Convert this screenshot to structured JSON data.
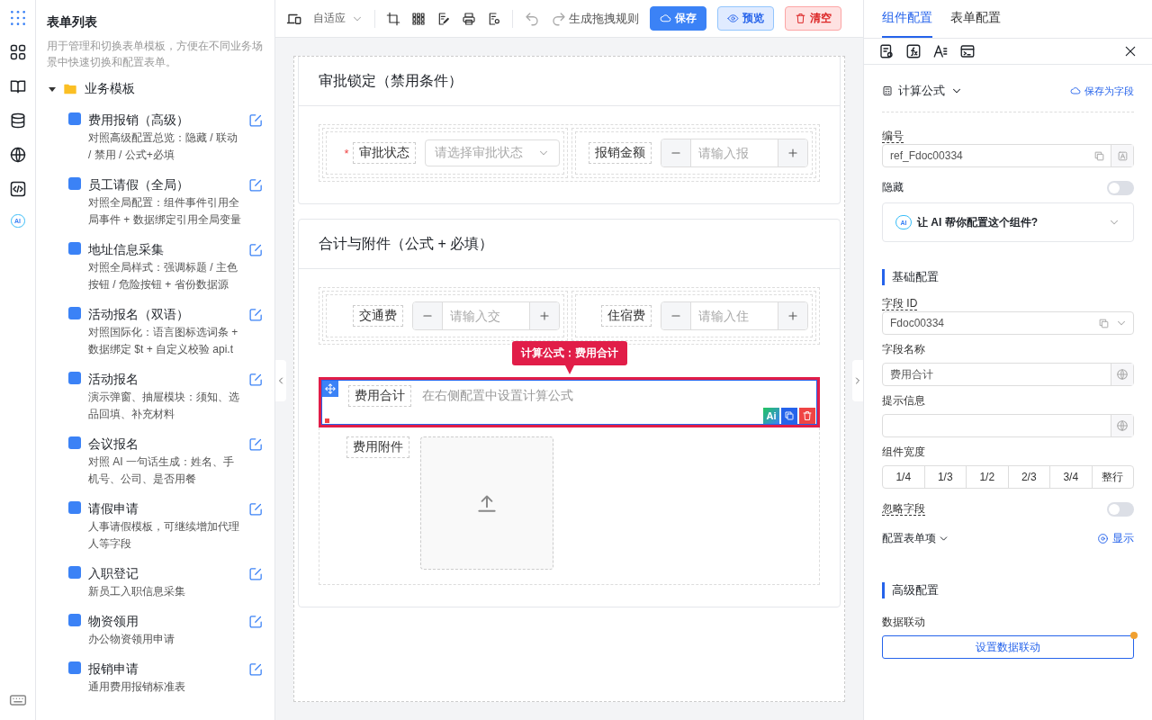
{
  "rail": {
    "ai_text": "AI"
  },
  "sidebar": {
    "title": "表单列表",
    "description": "用于管理和切换表单模板，方便在不同业务场景中快速切换和配置表单。",
    "folder": {
      "label": "业务模板",
      "expanded": true,
      "children": [
        {
          "title": "费用报销（高级）",
          "desc": "对照高级配置总览：隐藏 / 联动 / 禁用 / 公式+必填"
        },
        {
          "title": "员工请假（全局）",
          "desc": "对照全局配置：组件事件引用全局事件 + 数据绑定引用全局变量"
        },
        {
          "title": "地址信息采集",
          "desc": "对照全局样式：强调标题 / 主色按钮 / 危险按钮 + 省份数据源"
        },
        {
          "title": "活动报名（双语）",
          "desc": "对照国际化：语言图标选词条 + 数据绑定 $t + 自定义校验 api.t"
        },
        {
          "title": "活动报名",
          "desc": "演示弹窗、抽屉模块：须知、选品回填、补充材料"
        },
        {
          "title": "会议报名",
          "desc": "对照 AI 一句话生成：姓名、手机号、公司、是否用餐"
        },
        {
          "title": "请假申请",
          "desc": "人事请假模板，可继续增加代理人等字段"
        },
        {
          "title": "入职登记",
          "desc": "新员工入职信息采集"
        },
        {
          "title": "物资领用",
          "desc": "办公物资领用申请"
        },
        {
          "title": "报销申请",
          "desc": "通用费用报销标准表"
        }
      ]
    }
  },
  "toolbar": {
    "device_select": "自适应",
    "rule_label": "生成拖拽规则",
    "buttons": [
      {
        "label": "保存",
        "kind": "primary"
      },
      {
        "label": "预览",
        "kind": "preview"
      },
      {
        "label": "清空",
        "kind": "danger"
      }
    ]
  },
  "canvas": {
    "sections": [
      {
        "title": "审批锁定（禁用条件）",
        "fields": [
          {
            "kind": "select",
            "label": "审批状态",
            "required_mark": "*",
            "placeholder": "请选择审批状态"
          },
          {
            "kind": "number",
            "label": "报销金额",
            "placeholder": "请输入报"
          }
        ]
      },
      {
        "title": "合计与附件（公式 + 必填）",
        "fields": [
          {
            "kind": "number",
            "label": "交通费",
            "placeholder": "请输入交"
          },
          {
            "kind": "number",
            "label": "住宿费",
            "placeholder": "请输入住"
          }
        ],
        "formula": {
          "tooltip": "计算公式：费用合计",
          "label": "费用合计",
          "hint": "在右侧配置中设置计算公式",
          "selected": true,
          "ai_action": "Ai"
        },
        "upload": {
          "label": "费用附件"
        }
      }
    ]
  },
  "panel": {
    "tabs": [
      {
        "label": "组件配置",
        "selected": true
      },
      {
        "label": "表单配置",
        "selected": false
      }
    ],
    "component_type": "计算公式",
    "save_as_field": "保存为字段",
    "ref": {
      "label": "编号",
      "value": "ref_Fdoc00334"
    },
    "hidden": {
      "label": "隐藏",
      "on": false
    },
    "ai_assist": {
      "icon_text": "AI",
      "label": "让 AI 帮你配置这个组件?"
    },
    "basic_title": "基础配置",
    "field_id": {
      "label": "字段 ID",
      "value": "Fdoc00334"
    },
    "field_name": {
      "label": "字段名称",
      "value": "费用合计"
    },
    "hint": {
      "label": "提示信息"
    },
    "width": {
      "label": "组件宽度",
      "options": [
        {
          "label": "1/4",
          "selected": false
        },
        {
          "label": "1/3",
          "selected": false
        },
        {
          "label": "1/2",
          "selected": false
        },
        {
          "label": "2/3",
          "selected": false
        },
        {
          "label": "3/4",
          "selected": false
        },
        {
          "label": "整行",
          "selected": false
        }
      ]
    },
    "ignore": {
      "label": "忽略字段",
      "on": false
    },
    "config_items": {
      "label": "配置表单项",
      "action": "显示"
    },
    "advanced_title": "高级配置",
    "linkage": {
      "label": "数据联动",
      "button": "设置数据联动"
    }
  }
}
